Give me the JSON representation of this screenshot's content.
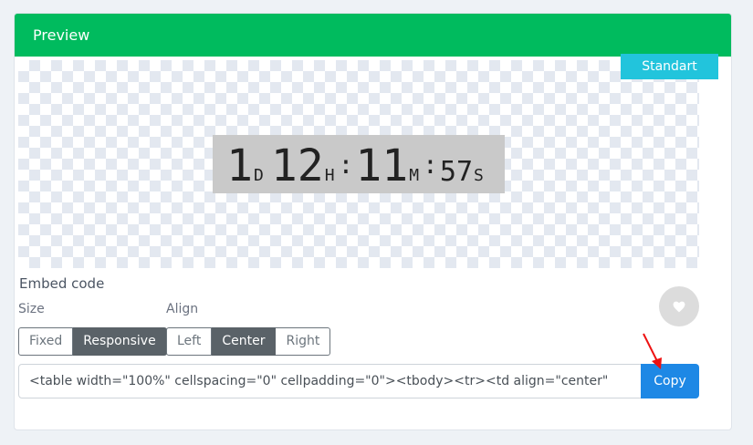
{
  "card": {
    "title": "Preview"
  },
  "preview": {
    "badge": "Standart",
    "countdown": {
      "days": "1",
      "days_unit": "D",
      "hours": "12",
      "hours_unit": "H",
      "minutes": "11",
      "minutes_unit": "M",
      "seconds": "57",
      "seconds_unit": "S",
      "separator": ":"
    }
  },
  "embed": {
    "label": "Embed code",
    "size_label": "Size",
    "align_label": "Align",
    "size_options": [
      "Fixed",
      "Responsive"
    ],
    "size_selected": "Responsive",
    "align_options": [
      "Left",
      "Center",
      "Right"
    ],
    "align_selected": "Center",
    "code_value": "<table width=\"100%\" cellspacing=\"0\" cellpadding=\"0\"><tbody><tr><td align=\"center\"",
    "copy_label": "Copy"
  },
  "icons": {
    "like": "heart-icon",
    "pointer": "red-arrow-annotation"
  },
  "colors": {
    "header": "#00bb5e",
    "badge": "#22c4dc",
    "copy": "#1e88e5",
    "annotation": "#e11"
  }
}
